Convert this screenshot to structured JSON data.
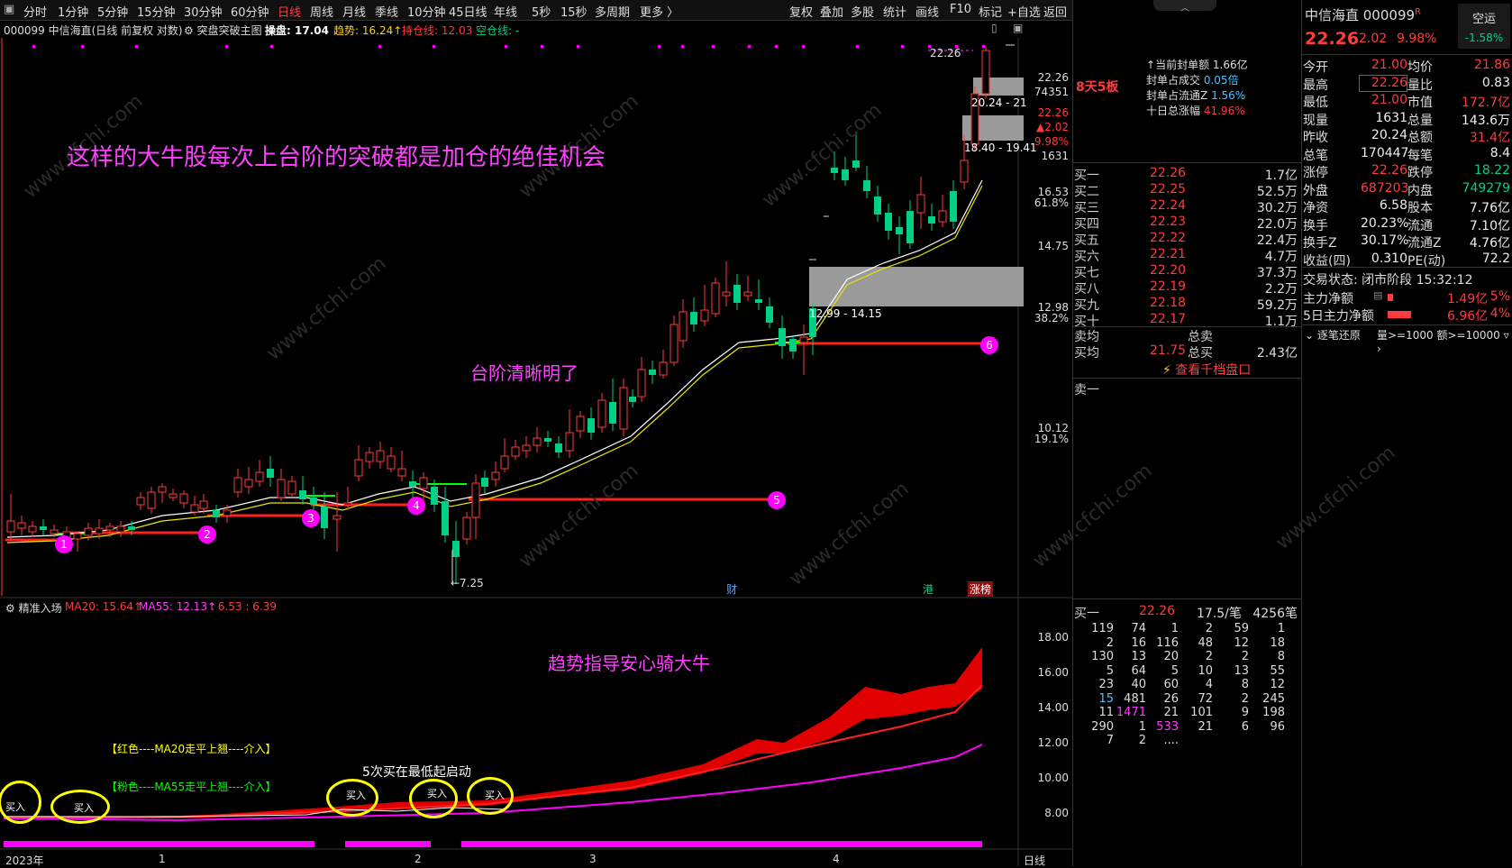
{
  "topbar": {
    "tabs": [
      "分时",
      "1分钟",
      "5分钟",
      "15分钟",
      "30分钟",
      "60分钟",
      "日线",
      "周线",
      "月线",
      "季线",
      "10分钟",
      "45日线",
      "年线",
      "5秒",
      "15秒",
      "多周期",
      "更多 〉"
    ],
    "active_tab": "日线",
    "right_buttons": [
      "复权",
      "叠加",
      "多股",
      "统计",
      "画线",
      "F10",
      "标记",
      "+自选",
      "返回"
    ]
  },
  "infobar": {
    "code_title": "000099 中信海直(日线 前复权 对数)",
    "indicator": "突盘突破主图",
    "caopan_label": "操盘: 17.04",
    "trend_label": "趋势: 16.24↑",
    "hold_label": "持仓线: 12.03",
    "empty_label": "空仓线: -"
  },
  "main_chart": {
    "annotations": {
      "headline": "这样的大牛股每次上台阶的突破都是加仓的绝佳机会",
      "steps": "台阶清晰明了",
      "trend": "趋势指导安心骑大牛",
      "five_buys": "5次买在最低起启动"
    },
    "markers": [
      "1",
      "2",
      "3",
      "4",
      "5",
      "6"
    ],
    "low_label": "←7.25",
    "high_label": "22.26",
    "zone_labels": [
      "20.24 - 21",
      "18.40 - 19.41",
      "12.99 - 14.15"
    ],
    "flags": [
      "财",
      "港",
      "涨榜"
    ],
    "y_axis": [
      "22.26",
      "74351",
      "22.26",
      "▲2.02",
      "9.98%",
      "1631",
      "16.53",
      "61.8%",
      "14.75",
      "12.98",
      "38.2%",
      "10.12",
      "19.1%"
    ],
    "board_tag": "8天5板",
    "limit_info": {
      "seal_amount": "当前封单额",
      "seal_amount_val": "1.66亿",
      "seal_ratio": "封单占成交",
      "seal_ratio_val": "0.05倍",
      "seal_float": "封单占流通Z",
      "seal_float_val": "1.56%",
      "ten_day": "十日总涨幅",
      "ten_day_val": "41.96%"
    }
  },
  "sub_chart": {
    "title": "精准入场",
    "ma20": "MA20: 15.64↑",
    "ma55": "MA55: 12.13↑",
    "extra": ": 6.53 : 6.39",
    "legend_red": "【红色----MA20走平上翘----介入】",
    "legend_pink": "【粉色----MA55走平上翘----介入】",
    "buy_label": "买入",
    "y_axis": [
      "18.00",
      "16.00",
      "14.00",
      "12.00",
      "10.00",
      "8.00"
    ]
  },
  "x_axis": {
    "labels": [
      "2023年",
      "1",
      "2",
      "3",
      "4"
    ],
    "period": "日线"
  },
  "order_book": {
    "bids": [
      {
        "label": "买一",
        "price": "22.26",
        "vol": "1.7亿"
      },
      {
        "label": "买二",
        "price": "22.25",
        "vol": "52.5万"
      },
      {
        "label": "买三",
        "price": "22.24",
        "vol": "30.2万"
      },
      {
        "label": "买四",
        "price": "22.23",
        "vol": "22.0万"
      },
      {
        "label": "买五",
        "price": "22.22",
        "vol": "22.4万"
      },
      {
        "label": "买六",
        "price": "22.21",
        "vol": "4.7万"
      },
      {
        "label": "买七",
        "price": "22.20",
        "vol": "37.3万"
      },
      {
        "label": "买八",
        "price": "22.19",
        "vol": "2.2万"
      },
      {
        "label": "买九",
        "price": "22.18",
        "vol": "59.2万"
      },
      {
        "label": "买十",
        "price": "22.17",
        "vol": "1.1万"
      }
    ],
    "sell_avg_label": "卖均",
    "total_sell_label": "总卖",
    "buy_avg_label": "买均",
    "buy_avg": "21.75",
    "total_buy_label": "总买",
    "total_buy": "2.43亿",
    "view_levels": "查看千档盘口",
    "sell_one": "卖一",
    "queue_header": {
      "label": "买一",
      "price": "22.26",
      "per": "17.5/笔",
      "count": "4256笔"
    },
    "queue": [
      [
        "119",
        "74",
        "1",
        "2",
        "59",
        "1"
      ],
      [
        "2",
        "16",
        "116",
        "48",
        "12",
        "18"
      ],
      [
        "130",
        "13",
        "20",
        "2",
        "2",
        "8"
      ],
      [
        "5",
        "64",
        "5",
        "10",
        "13",
        "55"
      ],
      [
        "23",
        "40",
        "60",
        "4",
        "8",
        "12"
      ],
      [
        "15",
        "481",
        "26",
        "72",
        "2",
        "245"
      ],
      [
        "11",
        "1471",
        "21",
        "101",
        "9",
        "198"
      ],
      [
        "290",
        "1",
        "533",
        "21",
        "6",
        "96"
      ],
      [
        "7",
        "2",
        "....",
        "",
        "",
        ""
      ]
    ]
  },
  "quote": {
    "name": "中信海直 000099",
    "tag": "R",
    "price": "22.26",
    "change": "2.02",
    "pct": "9.98%",
    "ai_label": "空运",
    "ai_pct": "-1.58%",
    "stats": [
      [
        "今开",
        "21.00",
        "均价",
        "21.86"
      ],
      [
        "最高",
        "22.26",
        "量比",
        "0.83"
      ],
      [
        "最低",
        "21.00",
        "市值",
        "172.7亿"
      ],
      [
        "现量",
        "1631",
        "总量",
        "143.6万"
      ],
      [
        "昨收",
        "20.24",
        "总额",
        "31.4亿"
      ],
      [
        "总笔",
        "170447",
        "每笔",
        "8.4"
      ],
      [
        "涨停",
        "22.26",
        "跌停",
        "18.22"
      ],
      [
        "外盘",
        "687203",
        "内盘",
        "749279"
      ],
      [
        "净资",
        "6.58",
        "股本",
        "7.76亿"
      ],
      [
        "换手",
        "20.23%",
        "流通",
        "7.10亿"
      ],
      [
        "换手Z",
        "30.17%",
        "流通Z",
        "4.76亿"
      ],
      [
        "收益(四)",
        "0.310",
        "PE(动)",
        "72.2"
      ]
    ],
    "trade_status": "交易状态: 闭市阶段 15:32:12",
    "main_net_label": "主力净额",
    "main_net": "1.49亿",
    "main_net_pct": "5%",
    "five_day_label": "5日主力净额",
    "five_day": "6.96亿",
    "five_day_pct": "4%",
    "footer": "逐笔还原",
    "footer2": "量>=1000 额>=10000"
  },
  "colors": {
    "up": "#ff3b3b",
    "down": "#00d084",
    "magenta": "#ff40ff",
    "yellow": "#ffff00"
  }
}
